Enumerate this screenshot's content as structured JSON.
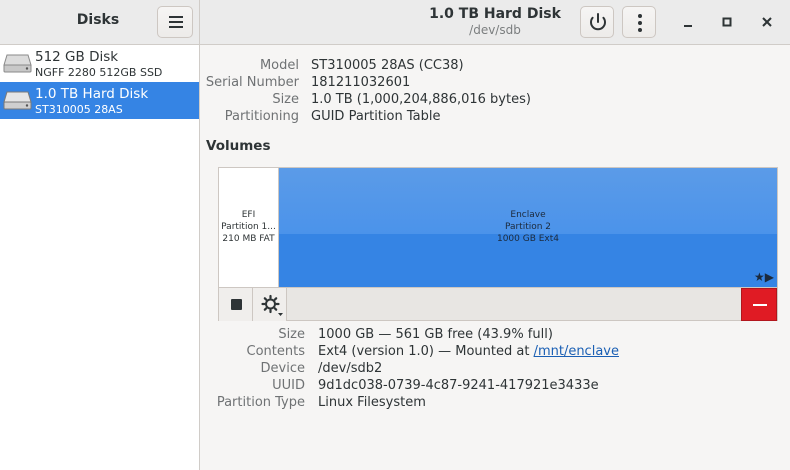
{
  "app": {
    "title": "Disks"
  },
  "header": {
    "title": "1.0 TB Hard Disk",
    "subtitle": "/dev/sdb"
  },
  "sidebar": {
    "items": [
      {
        "name": "512 GB Disk",
        "sub": "NGFF 2280 512GB SSD",
        "selected": false
      },
      {
        "name": "1.0 TB Hard Disk",
        "sub": "ST310005 28AS",
        "selected": true
      }
    ]
  },
  "drive": {
    "model_label": "Model",
    "model": "ST310005 28AS (CC38)",
    "serial_label": "Serial Number",
    "serial": "181211032601",
    "size_label": "Size",
    "size": "1.0 TB (1,000,204,886,016 bytes)",
    "partitioning_label": "Partitioning",
    "partitioning": "GUID Partition Table"
  },
  "volumes": {
    "title": "Volumes",
    "partitions": [
      {
        "line1": "EFI",
        "line2": "Partition 1...",
        "line3": "210 MB FAT"
      },
      {
        "line1": "Enclave",
        "line2": "Partition 2",
        "line3": "1000 GB Ext4"
      }
    ],
    "flags": "★▶"
  },
  "partition": {
    "size_label": "Size",
    "size": "1000 GB — 561 GB free (43.9% full)",
    "contents_label": "Contents",
    "contents_prefix": "Ext4 (version 1.0) — Mounted at ",
    "mount_point": "/mnt/enclave",
    "device_label": "Device",
    "device": "/dev/sdb2",
    "uuid_label": "UUID",
    "uuid": "9d1dc038-0739-4c87-9241-417921e3433e",
    "type_label": "Partition Type",
    "type": "Linux Filesystem"
  },
  "colors": {
    "accent": "#3584e4",
    "destructive": "#e01b24"
  }
}
